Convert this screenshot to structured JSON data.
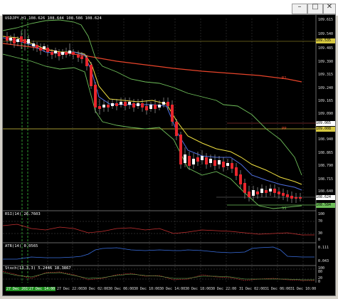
{
  "window": {
    "title": "USDJPY,H1"
  },
  "titlebar_buttons": {
    "minimize": "–",
    "maximize": "□",
    "close": "✕"
  },
  "chart": {
    "symbol_label": "USDJPY,H1",
    "ohlc": "108.626 108.644 108.586 108.624",
    "level_labels": {
      "r1": "R1",
      "pp": "PP",
      "s1": "S1"
    },
    "price_axis": [
      "109.615",
      "109.540",
      "109.485",
      "109.390",
      "109.315",
      "109.240",
      "109.165",
      "109.090",
      "109.015",
      "108.940",
      "108.865",
      "108.790",
      "108.715",
      "108.640"
    ],
    "axis_highlights": {
      "top": "109.535",
      "pp": "109.065",
      "pp2": "109.008",
      "last": "108.624",
      "s1": "108.584"
    },
    "time_axis": [
      "27 Dec 2019",
      "27 Dec 14:00",
      "27 Dec 22:00",
      "30 Dec 02:00",
      "30 Dec 06:00",
      "30 Dec 10:00",
      "30 Dec 14:00",
      "30 Dec 18:00",
      "30 Dec 22:00",
      "31 Dec 02:00",
      "31 Dec 06:00",
      "31 Dec 10:00"
    ]
  },
  "rsi": {
    "label": "RSI(14) 26.7603",
    "levels": [
      "100",
      "70",
      "30",
      "0"
    ]
  },
  "atr": {
    "label": "ATR(14) 0.0565",
    "levels": [
      "0.111",
      "0.043"
    ]
  },
  "stoch": {
    "label": "Stoch(13,3,3) 5.2446 18.3867",
    "levels": [
      "100",
      "80",
      "20",
      "0"
    ]
  },
  "colors": {
    "bg": "#000000",
    "bull": "#ffffff",
    "bear": "#e8262d",
    "ema_fast": "#4f6fe0",
    "ema_slow": "#f0e040",
    "ma_long": "#e8442a",
    "bands": "#6fbf5a",
    "grid": "#3a3a3a"
  }
}
